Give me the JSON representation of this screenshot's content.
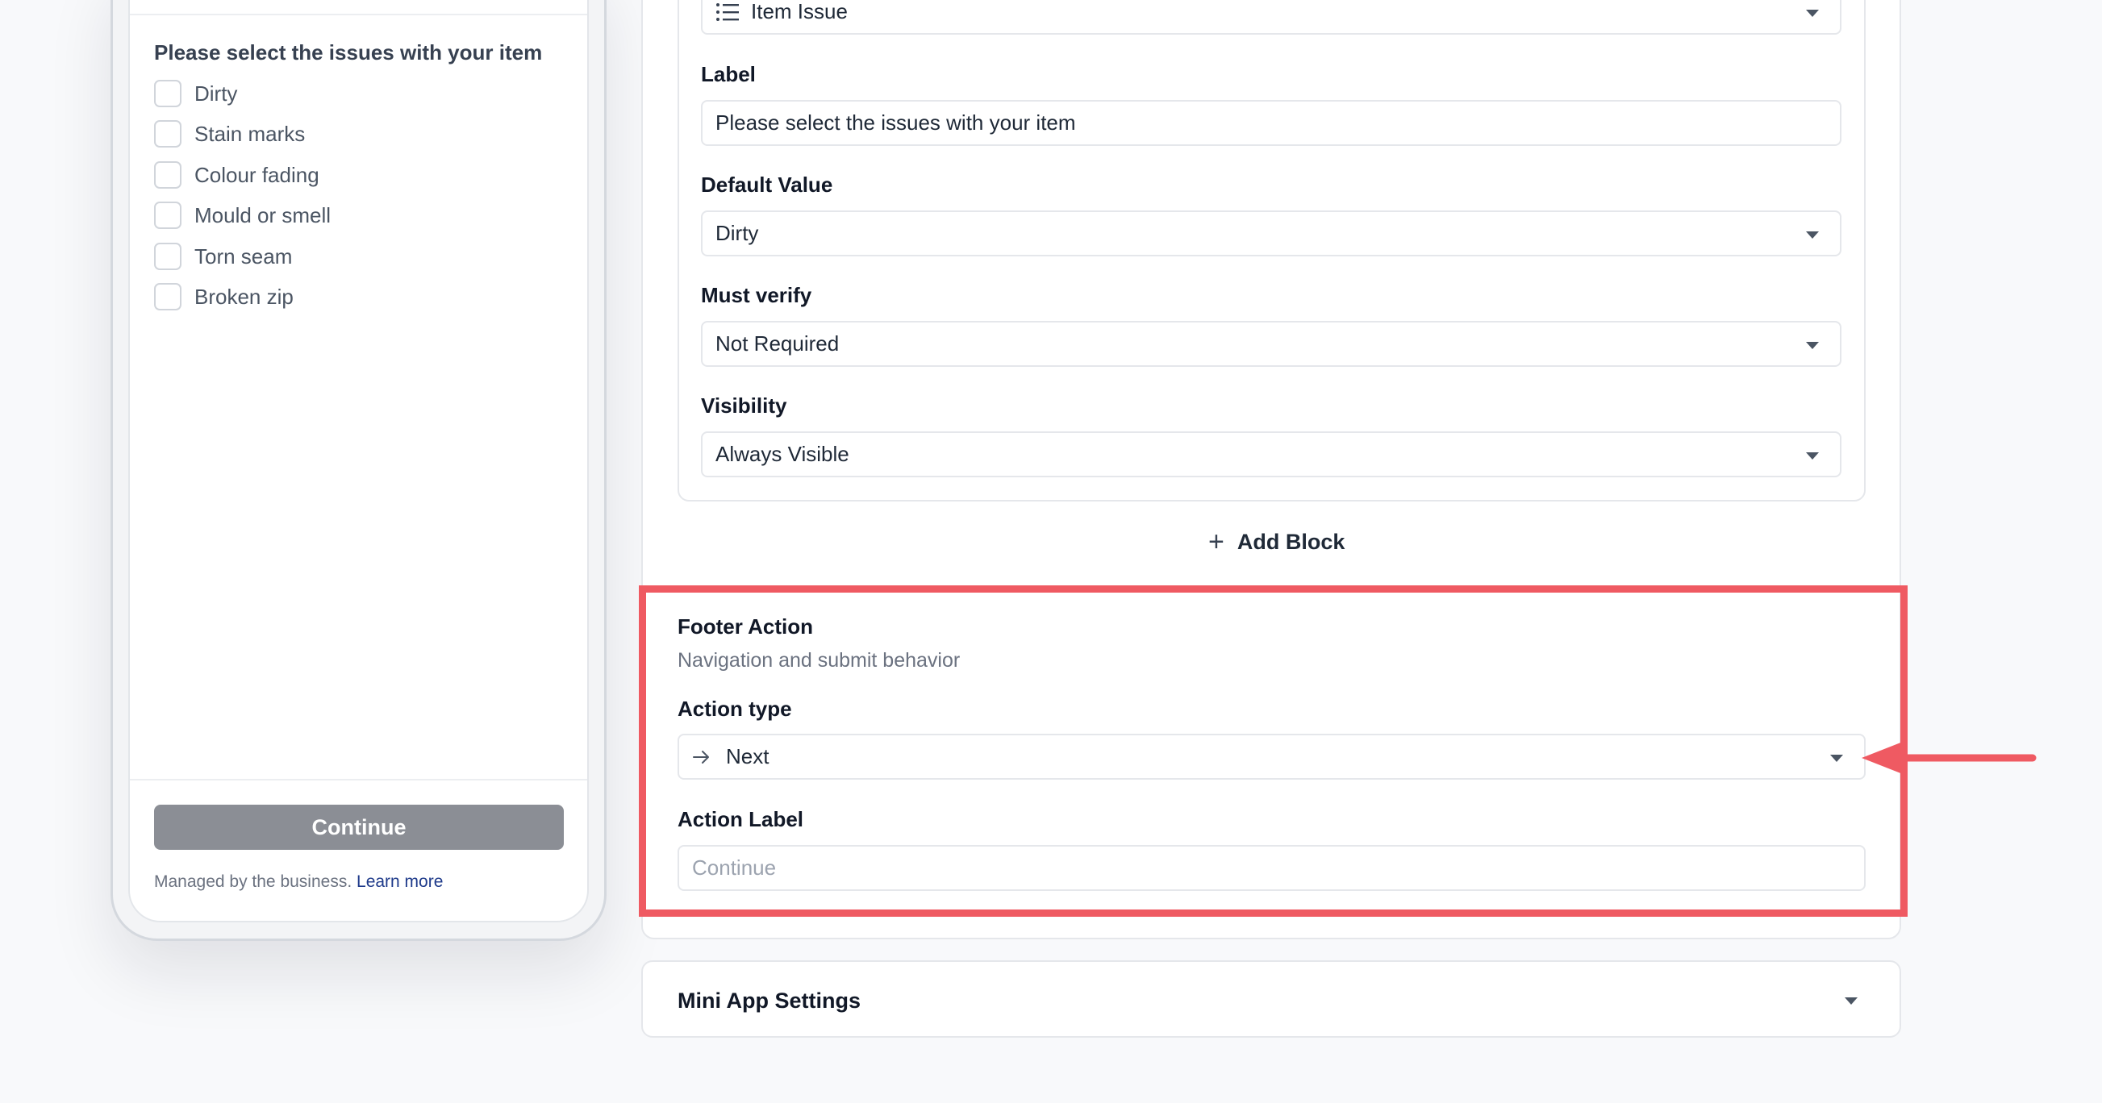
{
  "preview": {
    "question": "Please select the issues with your item",
    "options": [
      "Dirty",
      "Stain marks",
      "Colour fading",
      "Mould or smell",
      "Torn seam",
      "Broken zip"
    ],
    "continue_label": "Continue",
    "managed_text": "Managed by the business.",
    "learn_more": "Learn more"
  },
  "block": {
    "type_value": "Item Issue",
    "type_icon": "list-icon",
    "label_title": "Label",
    "label_value": "Please select the issues with your item",
    "default_title": "Default Value",
    "default_value": "Dirty",
    "verify_title": "Must verify",
    "verify_value": "Not Required",
    "visibility_title": "Visibility",
    "visibility_value": "Always Visible"
  },
  "add_block_label": "Add Block",
  "footer": {
    "title": "Footer Action",
    "subtitle": "Navigation and submit behavior",
    "action_type_title": "Action type",
    "action_type_value": "Next",
    "action_type_icon": "arrow-right-icon",
    "action_label_title": "Action Label",
    "action_label_placeholder": "Continue"
  },
  "mini_app_settings": "Mini App Settings",
  "colors": {
    "highlight": "#ef5a62",
    "continue_button": "#8b8e95",
    "link": "#1e3a8a"
  }
}
